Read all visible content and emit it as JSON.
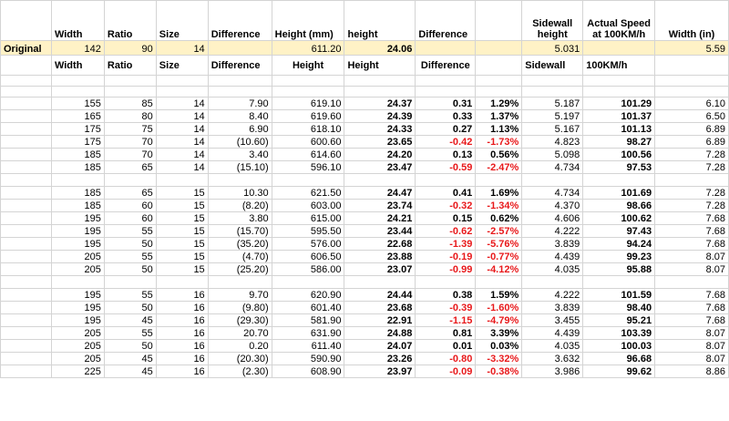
{
  "header1": [
    "",
    "Width",
    "Ratio",
    "Size",
    "Difference",
    "Height (mm)",
    "height",
    "Difference",
    "",
    "Sidewall height",
    "Actual Speed at 100KM/h",
    "Width (in)"
  ],
  "original": [
    "Original",
    "142",
    "90",
    "14",
    "",
    "611.20",
    "24.06",
    "",
    "",
    "5.031",
    "",
    "5.59"
  ],
  "header2": [
    "",
    "Width",
    "Ratio",
    "Size",
    "Difference",
    "Height",
    "Height",
    "Difference",
    "",
    "Sidewall",
    "100KM/h",
    ""
  ],
  "groups": [
    [
      [
        "155",
        "85",
        "14",
        "7.90",
        "619.10",
        "24.37",
        "0.31",
        "1.29%",
        "5.187",
        "101.29",
        "6.10"
      ],
      [
        "165",
        "80",
        "14",
        "8.40",
        "619.60",
        "24.39",
        "0.33",
        "1.37%",
        "5.197",
        "101.37",
        "6.50"
      ],
      [
        "175",
        "75",
        "14",
        "6.90",
        "618.10",
        "24.33",
        "0.27",
        "1.13%",
        "5.167",
        "101.13",
        "6.89"
      ],
      [
        "175",
        "70",
        "14",
        "(10.60)",
        "600.60",
        "23.65",
        "-0.42",
        "-1.73%",
        "4.823",
        "98.27",
        "6.89"
      ],
      [
        "185",
        "70",
        "14",
        "3.40",
        "614.60",
        "24.20",
        "0.13",
        "0.56%",
        "5.098",
        "100.56",
        "7.28"
      ],
      [
        "185",
        "65",
        "14",
        "(15.10)",
        "596.10",
        "23.47",
        "-0.59",
        "-2.47%",
        "4.734",
        "97.53",
        "7.28"
      ]
    ],
    [
      [
        "185",
        "65",
        "15",
        "10.30",
        "621.50",
        "24.47",
        "0.41",
        "1.69%",
        "4.734",
        "101.69",
        "7.28"
      ],
      [
        "185",
        "60",
        "15",
        "(8.20)",
        "603.00",
        "23.74",
        "-0.32",
        "-1.34%",
        "4.370",
        "98.66",
        "7.28"
      ],
      [
        "195",
        "60",
        "15",
        "3.80",
        "615.00",
        "24.21",
        "0.15",
        "0.62%",
        "4.606",
        "100.62",
        "7.68"
      ],
      [
        "195",
        "55",
        "15",
        "(15.70)",
        "595.50",
        "23.44",
        "-0.62",
        "-2.57%",
        "4.222",
        "97.43",
        "7.68"
      ],
      [
        "195",
        "50",
        "15",
        "(35.20)",
        "576.00",
        "22.68",
        "-1.39",
        "-5.76%",
        "3.839",
        "94.24",
        "7.68"
      ],
      [
        "205",
        "55",
        "15",
        "(4.70)",
        "606.50",
        "23.88",
        "-0.19",
        "-0.77%",
        "4.439",
        "99.23",
        "8.07"
      ],
      [
        "205",
        "50",
        "15",
        "(25.20)",
        "586.00",
        "23.07",
        "-0.99",
        "-4.12%",
        "4.035",
        "95.88",
        "8.07"
      ]
    ],
    [
      [
        "195",
        "55",
        "16",
        "9.70",
        "620.90",
        "24.44",
        "0.38",
        "1.59%",
        "4.222",
        "101.59",
        "7.68"
      ],
      [
        "195",
        "50",
        "16",
        "(9.80)",
        "601.40",
        "23.68",
        "-0.39",
        "-1.60%",
        "3.839",
        "98.40",
        "7.68"
      ],
      [
        "195",
        "45",
        "16",
        "(29.30)",
        "581.90",
        "22.91",
        "-1.15",
        "-4.79%",
        "3.455",
        "95.21",
        "7.68"
      ],
      [
        "205",
        "55",
        "16",
        "20.70",
        "631.90",
        "24.88",
        "0.81",
        "3.39%",
        "4.439",
        "103.39",
        "8.07"
      ],
      [
        "205",
        "50",
        "16",
        "0.20",
        "611.40",
        "24.07",
        "0.01",
        "0.03%",
        "4.035",
        "100.03",
        "8.07"
      ],
      [
        "205",
        "45",
        "16",
        "(20.30)",
        "590.90",
        "23.26",
        "-0.80",
        "-3.32%",
        "3.632",
        "96.68",
        "8.07"
      ],
      [
        "225",
        "45",
        "16",
        "(2.30)",
        "608.90",
        "23.97",
        "-0.09",
        "-0.38%",
        "3.986",
        "99.62",
        "8.86"
      ]
    ]
  ]
}
